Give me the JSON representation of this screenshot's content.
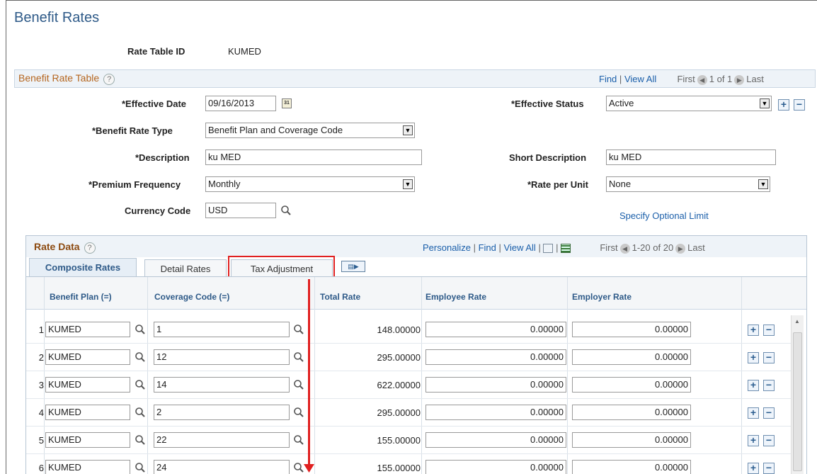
{
  "page": {
    "title": "Benefit Rates"
  },
  "header": {
    "rate_table_id_label": "Rate Table ID",
    "rate_table_id_value": "KUMED"
  },
  "benefit_rate_table": {
    "title": "Benefit Rate Table",
    "help": "?",
    "find": "Find",
    "sep": "|",
    "view_all": "View All",
    "first": "First",
    "count": "1 of 1",
    "last": "Last"
  },
  "form": {
    "effective_date_label": "*Effective Date",
    "effective_date_value": "09/16/2013",
    "calendar_text": "31",
    "effective_status_label": "*Effective Status",
    "effective_status_value": "Active",
    "benefit_rate_type_label": "*Benefit Rate Type",
    "benefit_rate_type_value": "Benefit Plan and Coverage Code",
    "description_label": "*Description",
    "description_value": "ku MED",
    "short_description_label": "Short Description",
    "short_description_value": "ku MED",
    "premium_frequency_label": "*Premium Frequency",
    "premium_frequency_value": "Monthly",
    "rate_per_unit_label": "*Rate per Unit",
    "rate_per_unit_value": "None",
    "currency_code_label": "Currency Code",
    "currency_code_value": "USD",
    "specify_optional_limit": "Specify Optional Limit"
  },
  "rate_data": {
    "title": "Rate Data",
    "help": "?",
    "personalize": "Personalize",
    "find": "Find",
    "view_all": "View All",
    "sep": "|",
    "first": "First",
    "count": "1-20 of 20",
    "last": "Last",
    "tabs": [
      {
        "label": "Composite Rates"
      },
      {
        "label": "Detail Rates"
      },
      {
        "label": "Tax Adjustment"
      }
    ],
    "columns": [
      "Benefit Plan (=)",
      "Coverage Code (=)",
      "Total Rate",
      "Employee Rate",
      "Employer Rate"
    ],
    "rows": [
      {
        "num": "1",
        "plan": "KUMED",
        "code": "1",
        "total": "148.00000",
        "employee": "0.00000",
        "employer": "0.00000"
      },
      {
        "num": "2",
        "plan": "KUMED",
        "code": "12",
        "total": "295.00000",
        "employee": "0.00000",
        "employer": "0.00000"
      },
      {
        "num": "3",
        "plan": "KUMED",
        "code": "14",
        "total": "622.00000",
        "employee": "0.00000",
        "employer": "0.00000"
      },
      {
        "num": "4",
        "plan": "KUMED",
        "code": "2",
        "total": "295.00000",
        "employee": "0.00000",
        "employer": "0.00000"
      },
      {
        "num": "5",
        "plan": "KUMED",
        "code": "22",
        "total": "155.00000",
        "employee": "0.00000",
        "employer": "0.00000"
      },
      {
        "num": "6",
        "plan": "KUMED",
        "code": "24",
        "total": "155.00000",
        "employee": "0.00000",
        "employer": "0.00000"
      }
    ],
    "add_symbol": "+",
    "remove_symbol": "−"
  },
  "colors": {
    "title": "#2e5a88",
    "highlight": "#e02020",
    "link": "#1b5faa"
  }
}
